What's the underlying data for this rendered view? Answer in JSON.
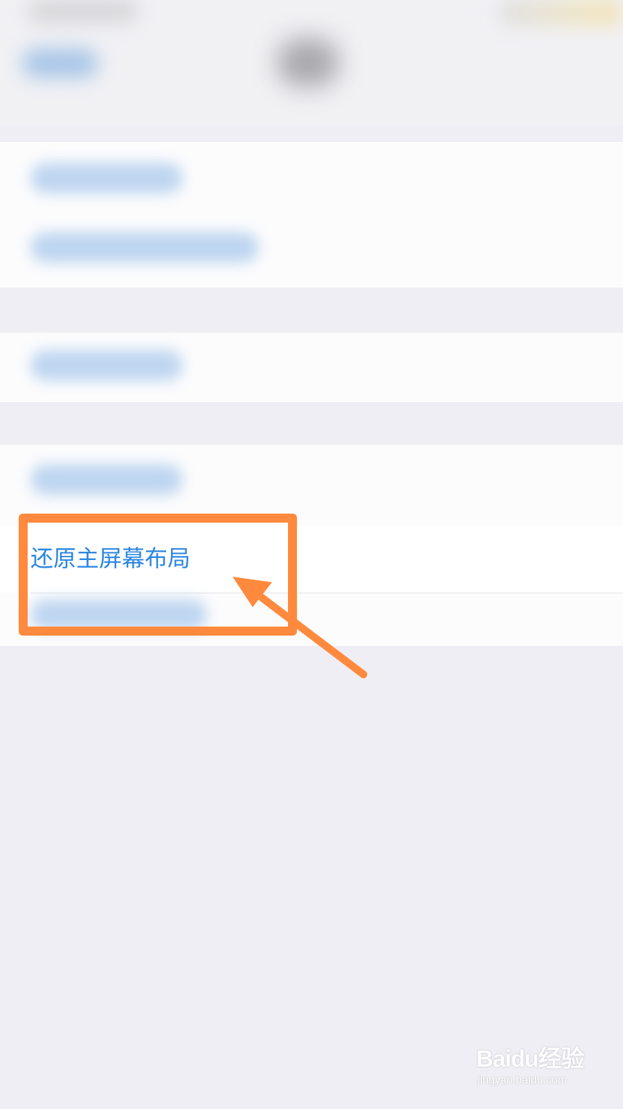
{
  "settings_list": {
    "restore_home_screen_layout_label": "还原主屏幕布局"
  },
  "colors": {
    "link_blue": "#2c86e0",
    "annotation_orange": "#ff8a3d",
    "background": "#efeef4"
  },
  "watermark": {
    "brand_text": "Baidu经验",
    "url_text": "jingyan.baidu.com"
  }
}
